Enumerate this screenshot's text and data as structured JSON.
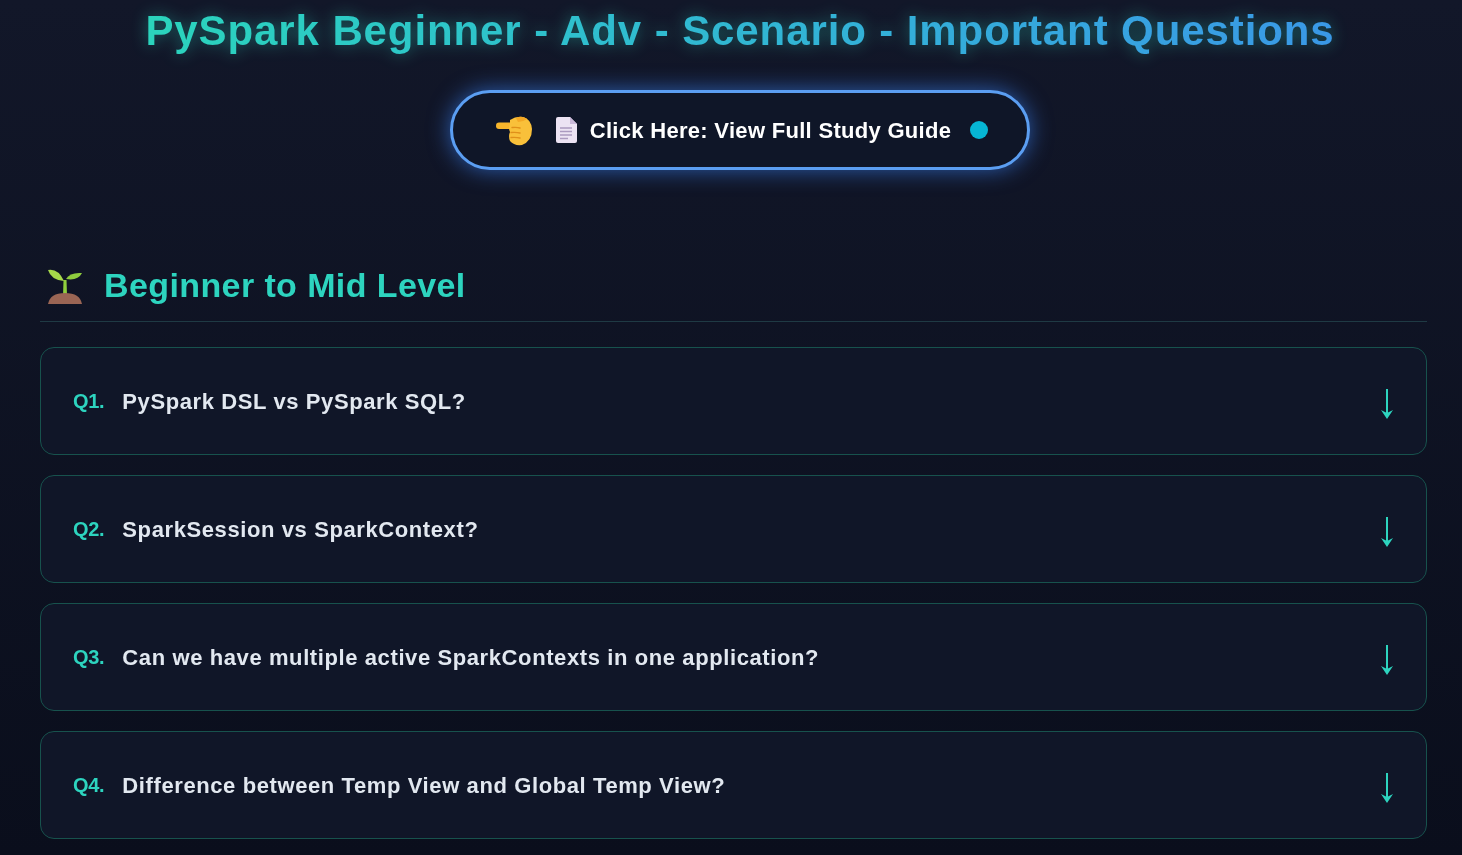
{
  "title": "PySpark Beginner - Adv - Scenario - Important Questions",
  "study_guide_button": {
    "label": "Click Here: View Full Study Guide"
  },
  "sections": [
    {
      "heading": "Beginner to Mid Level",
      "questions": [
        {
          "number": "Q1.",
          "text": "PySpark DSL vs PySpark SQL?",
          "expanded": false
        },
        {
          "number": "Q2.",
          "text": "SparkSession vs SparkContext?",
          "expanded": false
        },
        {
          "number": "Q3.",
          "text": "Can we have multiple active SparkContexts in one application?",
          "expanded": false
        },
        {
          "number": "Q4.",
          "text": "Difference between Temp View and Global Temp View?",
          "expanded": false
        }
      ]
    }
  ]
}
